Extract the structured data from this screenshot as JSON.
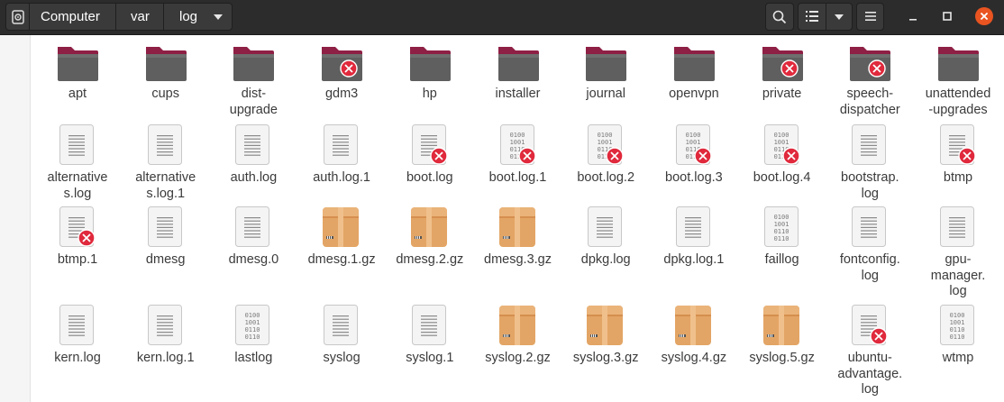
{
  "header": {
    "breadcrumbs": [
      "Computer",
      "var",
      "log"
    ],
    "icons": {
      "drive": "drive-icon",
      "dropdown": "chevron-down-icon",
      "search": "search-icon",
      "view_list": "list-view-icon",
      "view_dropdown": "chevron-down-icon",
      "menu": "hamburger-menu-icon",
      "minimize": "minimize-icon",
      "maximize": "maximize-icon",
      "close": "close-icon"
    }
  },
  "colors": {
    "header_bg": "#2c2c2c",
    "folder_tab": "#8e1f45",
    "folder_body": "#5f5f5f",
    "archive": "#e3a565",
    "close_btn": "#e95420",
    "error_badge": "#e0293c"
  },
  "files": [
    {
      "name": "apt",
      "type": "folder",
      "locked": false
    },
    {
      "name": "cups",
      "type": "folder",
      "locked": false
    },
    {
      "name": "dist-\nupgrade",
      "type": "folder",
      "locked": false
    },
    {
      "name": "gdm3",
      "type": "folder",
      "locked": true
    },
    {
      "name": "hp",
      "type": "folder",
      "locked": false
    },
    {
      "name": "installer",
      "type": "folder",
      "locked": false
    },
    {
      "name": "journal",
      "type": "folder",
      "locked": false
    },
    {
      "name": "openvpn",
      "type": "folder",
      "locked": false
    },
    {
      "name": "private",
      "type": "folder",
      "locked": true
    },
    {
      "name": "speech-\ndispatcher",
      "type": "folder",
      "locked": true
    },
    {
      "name": "unattended\n-upgrades",
      "type": "folder",
      "locked": false
    },
    {
      "name": "alternative\ns.log",
      "type": "text",
      "locked": false
    },
    {
      "name": "alternative\ns.log.1",
      "type": "text",
      "locked": false
    },
    {
      "name": "auth.log",
      "type": "text",
      "locked": false
    },
    {
      "name": "auth.log.1",
      "type": "text",
      "locked": false
    },
    {
      "name": "boot.log",
      "type": "text",
      "locked": true
    },
    {
      "name": "boot.log.1",
      "type": "binary",
      "locked": true
    },
    {
      "name": "boot.log.2",
      "type": "binary",
      "locked": true
    },
    {
      "name": "boot.log.3",
      "type": "binary",
      "locked": true
    },
    {
      "name": "boot.log.4",
      "type": "binary",
      "locked": true
    },
    {
      "name": "bootstrap.\nlog",
      "type": "text",
      "locked": false
    },
    {
      "name": "btmp",
      "type": "text",
      "locked": true
    },
    {
      "name": "btmp.1",
      "type": "text",
      "locked": true
    },
    {
      "name": "dmesg",
      "type": "text",
      "locked": false
    },
    {
      "name": "dmesg.0",
      "type": "text",
      "locked": false
    },
    {
      "name": "dmesg.1.gz",
      "type": "archive",
      "locked": false
    },
    {
      "name": "dmesg.2.gz",
      "type": "archive",
      "locked": false
    },
    {
      "name": "dmesg.3.gz",
      "type": "archive",
      "locked": false
    },
    {
      "name": "dpkg.log",
      "type": "text",
      "locked": false
    },
    {
      "name": "dpkg.log.1",
      "type": "text",
      "locked": false
    },
    {
      "name": "faillog",
      "type": "binary",
      "locked": false
    },
    {
      "name": "fontconfig.\nlog",
      "type": "text",
      "locked": false
    },
    {
      "name": "gpu-\nmanager.\nlog",
      "type": "text",
      "locked": false
    },
    {
      "name": "kern.log",
      "type": "text",
      "locked": false
    },
    {
      "name": "kern.log.1",
      "type": "text",
      "locked": false
    },
    {
      "name": "lastlog",
      "type": "binary",
      "locked": false
    },
    {
      "name": "syslog",
      "type": "text",
      "locked": false
    },
    {
      "name": "syslog.1",
      "type": "text",
      "locked": false
    },
    {
      "name": "syslog.2.gz",
      "type": "archive",
      "locked": false
    },
    {
      "name": "syslog.3.gz",
      "type": "archive",
      "locked": false
    },
    {
      "name": "syslog.4.gz",
      "type": "archive",
      "locked": false
    },
    {
      "name": "syslog.5.gz",
      "type": "archive",
      "locked": false
    },
    {
      "name": "ubuntu-\nadvantage.\nlog",
      "type": "text",
      "locked": true
    },
    {
      "name": "wtmp",
      "type": "binary",
      "locked": false
    }
  ]
}
